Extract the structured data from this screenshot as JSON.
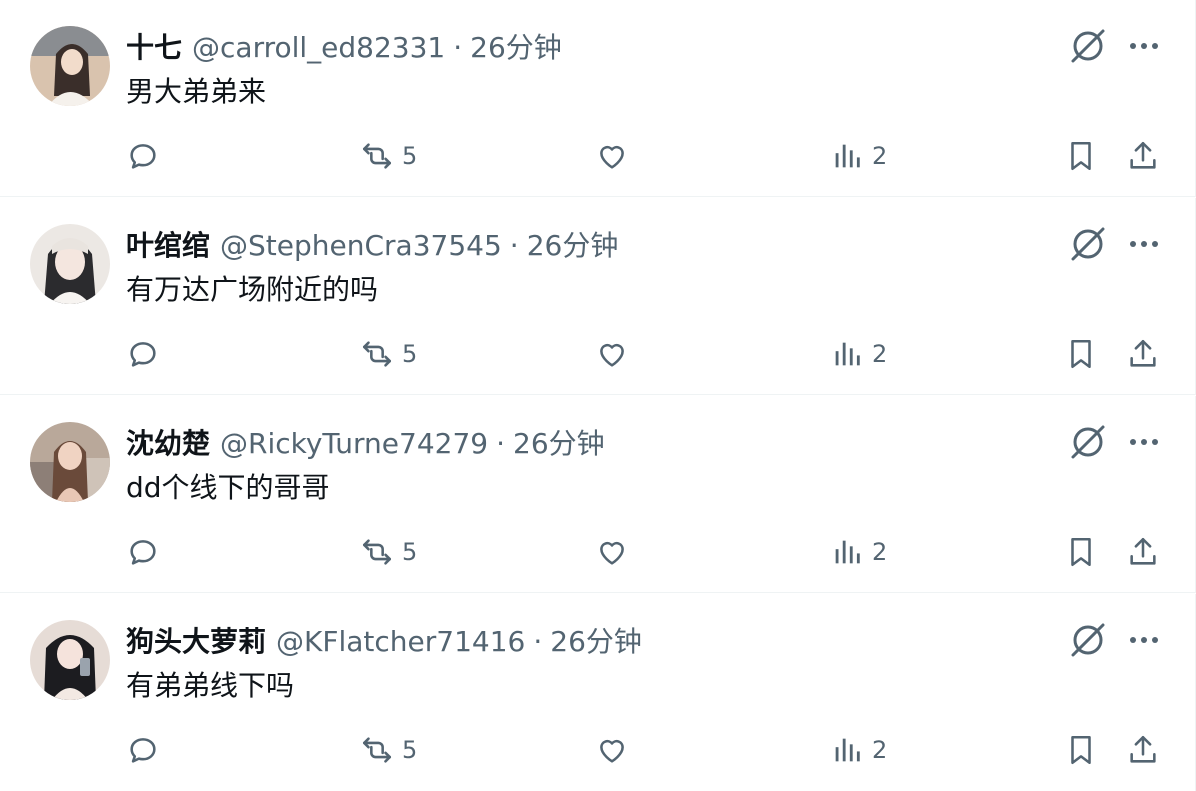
{
  "tweets": [
    {
      "name": "十七",
      "handle": "@carroll_ed82331",
      "dot": "·",
      "time": "26分钟",
      "text": "男大弟弟来",
      "retweets": "5",
      "views": "2",
      "avatar_colors": [
        "#d9c3ae",
        "#3a2e2a"
      ]
    },
    {
      "name": "叶绾绾",
      "handle": "@StephenCra37545",
      "dot": "·",
      "time": "26分钟",
      "text": "有万达广场附近的吗",
      "retweets": "5",
      "views": "2",
      "avatar_colors": [
        "#ece8e4",
        "#2b2b2e"
      ]
    },
    {
      "name": "沈幼楚",
      "handle": "@RickyTurne74279",
      "dot": "·",
      "time": "26分钟",
      "text": "dd个线下的哥哥",
      "retweets": "5",
      "views": "2",
      "avatar_colors": [
        "#b9a89a",
        "#6a4a3a"
      ]
    },
    {
      "name": "狗头大萝莉",
      "handle": "@KFlatcher71416",
      "dot": "·",
      "time": "26分钟",
      "text": "有弟弟线下吗",
      "retweets": "5",
      "views": "2",
      "avatar_colors": [
        "#e6dcd6",
        "#1c1c20"
      ]
    }
  ],
  "colors": {
    "text_primary": "#0f1419",
    "text_secondary": "#536471",
    "divider": "#eff3f4",
    "background": "#ffffff"
  }
}
